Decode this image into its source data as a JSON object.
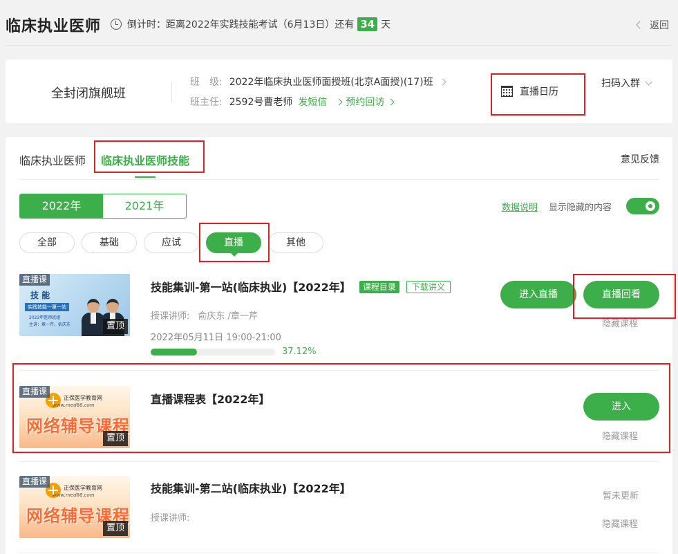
{
  "header": {
    "title": "临床执业医师",
    "countdown_prefix": "倒计时：距离2022年实践技能考试（6月13日）还有",
    "countdown_days": "34",
    "countdown_suffix": "天",
    "back_label": "返回"
  },
  "class_info": {
    "name": "全封闭旗舰班",
    "class_label": "班　级:",
    "class_value": "2022年临床执业医师面授班(北京A面授)(17)班",
    "teacher_label": "班主任:",
    "teacher_value": "2592号曹老师",
    "sms_link": "发短信",
    "appointment_link": "预约回访",
    "calendar_label": "直播日历",
    "scan_label": "扫码入群"
  },
  "subject_tabs": [
    "临床执业医师",
    "临床执业医师技能"
  ],
  "feedback_label": "意见反馈",
  "years": [
    "2022年",
    "2021年"
  ],
  "data_note_label": "数据说明",
  "show_hidden_label": "显示隐藏的内容",
  "filters": [
    "全部",
    "基础",
    "应试",
    "直播",
    "其他"
  ],
  "courses": [
    {
      "tag": "直播课",
      "pin": "置顶",
      "thumb_title": "技 能",
      "thumb_sub": "实践技能一第一站",
      "thumb_year": "2022年医师班组",
      "thumb_lecturers": "主讲：章一芹、俞庆东",
      "title": "技能集训-第一站(临床执业)【2022年】",
      "badge_catalog": "课程目录",
      "badge_download": "下载讲义",
      "teacher_label": "授课讲师:",
      "teachers": "俞庆东 /章一芹",
      "time": "2022年05月11日 19:00-21:00",
      "progress": 37.12,
      "progress_label": "37.12%",
      "btn_live": "进入直播",
      "btn_replay": "直播回看",
      "hide_label": "隐藏课程"
    },
    {
      "tag": "直播课",
      "pin": "置顶",
      "brand_name": "正保医学教育网",
      "brand_url": "www.med66.com",
      "banner": "网络辅导课程",
      "title": "直播课程表【2022年】",
      "btn_enter": "进入",
      "hide_label": "隐藏课程"
    },
    {
      "tag": "直播课",
      "pin": "置顶",
      "brand_name": "正保医学教育网",
      "brand_url": "www.med66.com",
      "banner": "网络辅导课程",
      "title": "技能集训-第二站(临床执业)【2022年】",
      "teacher_label": "授课讲师:",
      "status": "暂未更新",
      "hide_label": "隐藏课程"
    }
  ],
  "colors": {
    "accent": "#3cae4a",
    "highlight": "#e02020"
  }
}
